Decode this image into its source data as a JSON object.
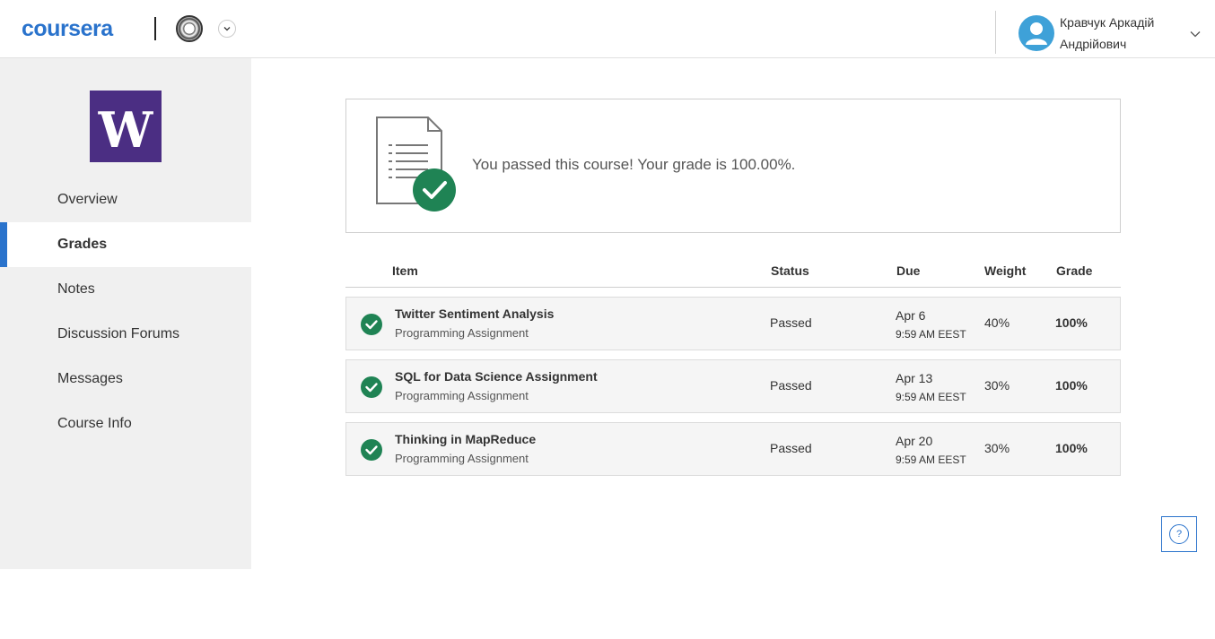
{
  "header": {
    "brand": "coursera",
    "user_name": "Кравчук Аркадій Андрійович"
  },
  "sidebar": {
    "course_logo_letter": "W",
    "items": [
      {
        "label": "Overview"
      },
      {
        "label": "Grades"
      },
      {
        "label": "Notes"
      },
      {
        "label": "Discussion Forums"
      },
      {
        "label": "Messages"
      },
      {
        "label": "Course Info"
      }
    ],
    "active_item": "Grades"
  },
  "summary": {
    "message": "You passed this course! Your grade is 100.00%."
  },
  "grades_table": {
    "headers": {
      "item": "Item",
      "status": "Status",
      "due": "Due",
      "weight": "Weight",
      "grade": "Grade"
    },
    "rows": [
      {
        "name": "Twitter Sentiment Analysis",
        "type": "Programming Assignment",
        "status": "Passed",
        "due_date": "Apr 6",
        "due_time": "9:59 AM EEST",
        "weight": "40%",
        "grade": "100%"
      },
      {
        "name": "SQL for Data Science Assignment",
        "type": "Programming Assignment",
        "status": "Passed",
        "due_date": "Apr 13",
        "due_time": "9:59 AM EEST",
        "weight": "30%",
        "grade": "100%"
      },
      {
        "name": "Thinking in MapReduce",
        "type": "Programming Assignment",
        "status": "Passed",
        "due_date": "Apr 20",
        "due_time": "9:59 AM EEST",
        "weight": "30%",
        "grade": "100%"
      }
    ]
  },
  "help": {
    "label": "?"
  },
  "colors": {
    "brand_blue": "#2a73cc",
    "success_green": "#1f8354",
    "course_purple": "#4b2e83",
    "avatar_blue": "#3ea1d8"
  },
  "icons": {
    "org": "university-seal-icon",
    "dropdown": "chevron-down-icon",
    "avatar": "user-avatar-icon",
    "summary": "document-check-icon",
    "row_status": "check-circle-icon",
    "help": "help-icon"
  }
}
